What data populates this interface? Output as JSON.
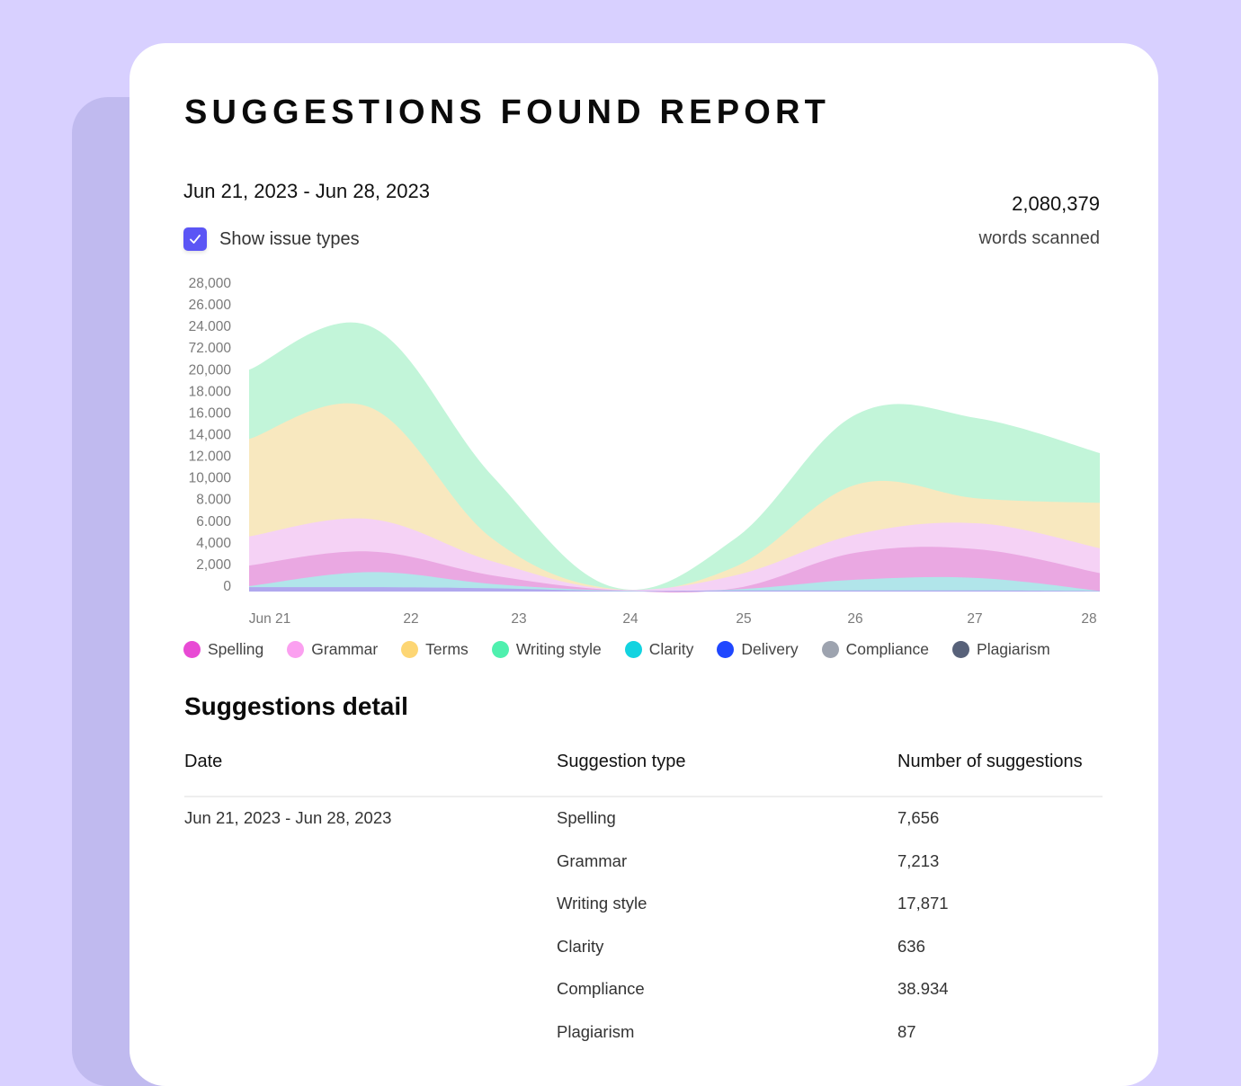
{
  "report": {
    "title": "SUGGESTIONS FOUND REPORT",
    "date_range": "Jun 21, 2023 - Jun 28, 2023",
    "words_scanned_count": "2,080,379",
    "words_scanned_label": "words scanned",
    "show_issue_types": {
      "label": "Show issue types",
      "checked": true
    }
  },
  "colors": {
    "background": "#d8d0ff",
    "back_card": "#c0baef",
    "checkbox": "#5b55f5"
  },
  "legend": [
    {
      "label": "Spelling",
      "color": "#e84ad4"
    },
    {
      "label": "Grammar",
      "color": "#fba0f0"
    },
    {
      "label": "Terms",
      "color": "#fdd674"
    },
    {
      "label": "Writing style",
      "color": "#4ff0ae"
    },
    {
      "label": "Clarity",
      "color": "#12d3e0"
    },
    {
      "label": "Delivery",
      "color": "#1f47ff"
    },
    {
      "label": "Compliance",
      "color": "#9da3af"
    },
    {
      "label": "Plagiarism",
      "color": "#576179"
    }
  ],
  "chart_data": {
    "type": "area",
    "stacked": true,
    "title": "",
    "xlabel": "",
    "ylabel": "",
    "x": [
      "Jun 21",
      "22",
      "23",
      "24",
      "25",
      "26",
      "27",
      "28"
    ],
    "y_tick_labels": [
      "28,000",
      "26.000",
      "24.000",
      "72.000",
      "20,000",
      "18.000",
      "16.000",
      "14,000",
      "12.000",
      "10,000",
      "8.000",
      "6.000",
      "4,000",
      "2,000",
      "0"
    ],
    "ylim": [
      0,
      28000
    ],
    "grid": false,
    "legend_position": "bottom",
    "series": [
      {
        "name": "Delivery",
        "fill": "#b0a8ee",
        "values": [
          400,
          400,
          300,
          50,
          100,
          100,
          100,
          50
        ]
      },
      {
        "name": "Clarity",
        "fill": "#b1e5ea",
        "values": [
          100,
          1400,
          400,
          50,
          100,
          1000,
          1150,
          0
        ]
      },
      {
        "name": "Spelling",
        "fill": "#eaa8e2",
        "values": [
          1900,
          1900,
          800,
          50,
          100,
          2500,
          2650,
          1650
        ]
      },
      {
        "name": "Grammar",
        "fill": "#f5d2f5",
        "values": [
          2700,
          3000,
          1300,
          50,
          1200,
          1700,
          2400,
          2300
        ]
      },
      {
        "name": "Terms",
        "fill": "#f8e8bf",
        "values": [
          9000,
          10300,
          2100,
          50,
          800,
          4600,
          2300,
          4200
        ]
      },
      {
        "name": "Writing style",
        "fill": "#c2f5d9",
        "values": [
          6400,
          7500,
          5800,
          150,
          2600,
          6500,
          7400,
          4600
        ]
      }
    ]
  },
  "detail": {
    "title": "Suggestions detail",
    "columns": [
      "Date",
      "Suggestion type",
      "Number of suggestions"
    ],
    "date_value": "Jun 21, 2023 - Jun 28, 2023",
    "rows": [
      {
        "type": "Spelling",
        "count": "7,656"
      },
      {
        "type": "Grammar",
        "count": "7,213"
      },
      {
        "type": "Writing style",
        "count": "17,871"
      },
      {
        "type": "Clarity",
        "count": "636"
      },
      {
        "type": "Compliance",
        "count": "38.934"
      },
      {
        "type": "Plagiarism",
        "count": "87"
      }
    ]
  }
}
